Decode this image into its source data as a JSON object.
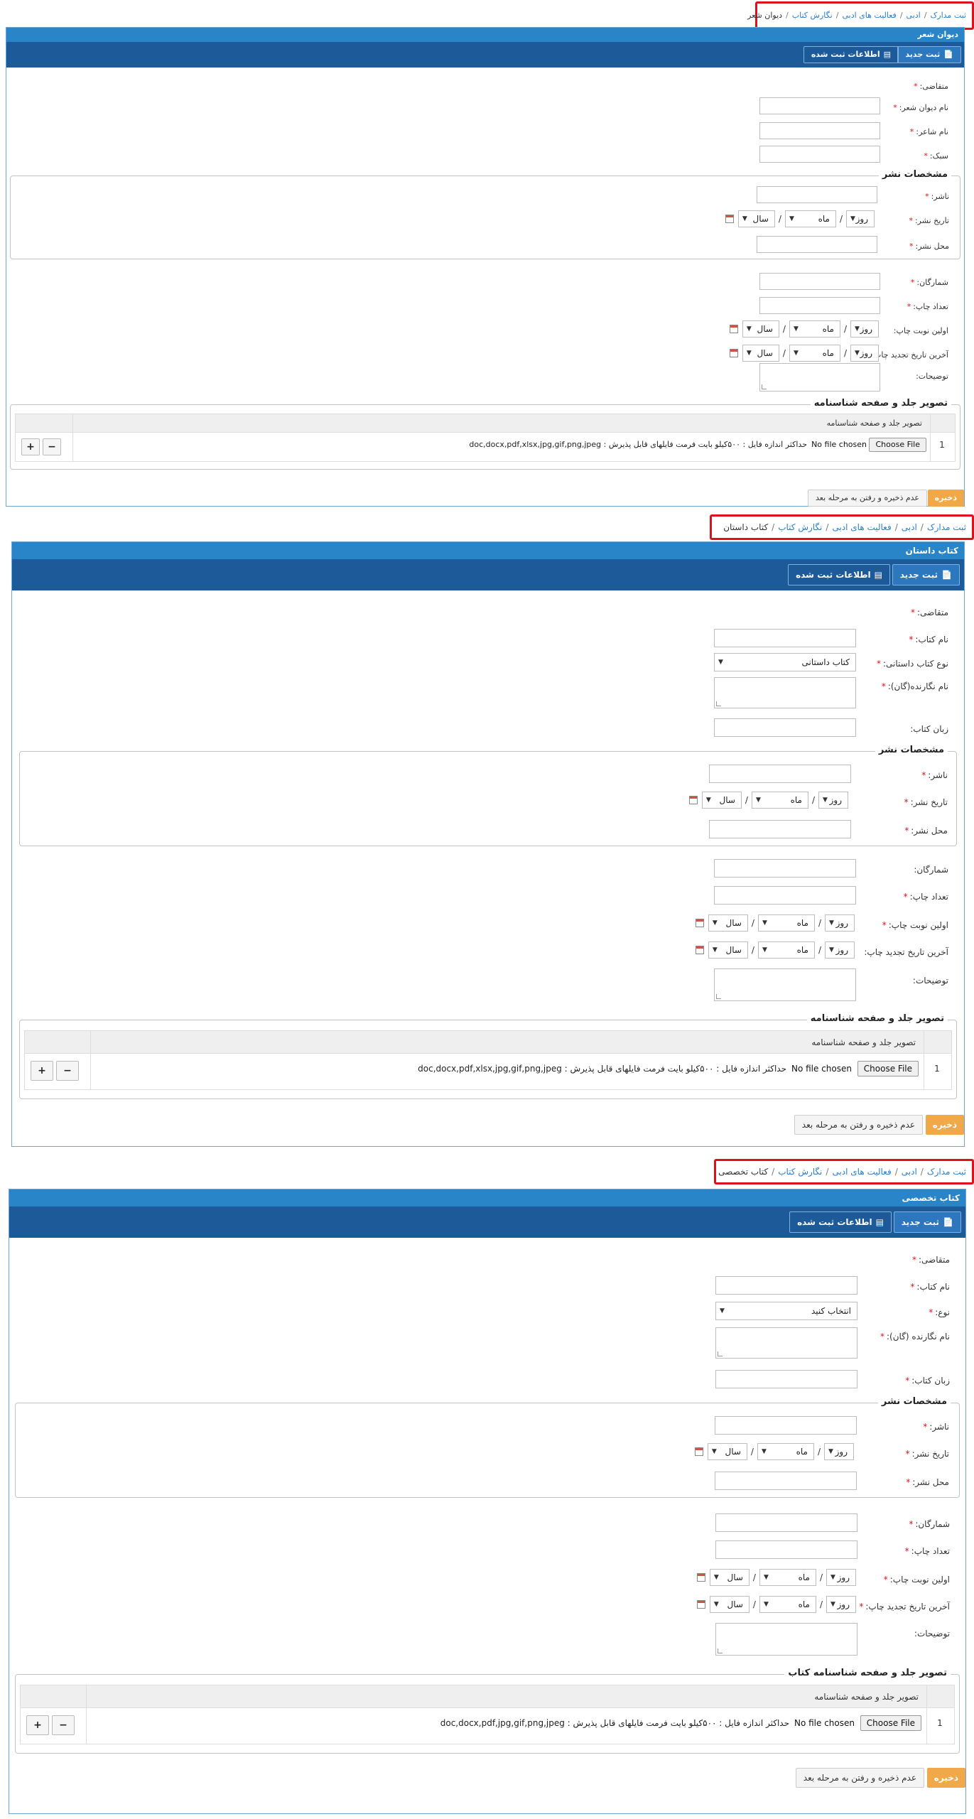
{
  "common": {
    "tab_new": "ثبت جدید",
    "tab_info": "اطلاعات ثبت شده",
    "legend_publish": "مشخصات نشر",
    "th_image": "تصویر جلد و صفحه شناسنامه",
    "choose_file": "Choose File",
    "no_file": "No file chosen",
    "hint": "حداکثر اندازه فایل : ۵۰۰کیلو بایت فرمت فایلهای قابل پذیرش : doc,docx,pdf,xlsx,jpg,gif,png,jpeg",
    "hint_alt": "حداکثر اندازه فایل : ۵۰۰کیلو بایت فرمت فایلهای قابل پذیرش : doc,docx,pdf,jpg,gif,png,jpeg",
    "row_num": "1",
    "plus": "+",
    "minus": "−",
    "save": "ذخیره",
    "skip": "عدم ذخیره و رفتن به مرحله بعد",
    "day": "روز",
    "month": "ماه",
    "year": "سال",
    "slash": "/",
    "star": "*"
  },
  "sections": [
    {
      "breadcrumb": [
        "ثبت مدارک",
        "ادبی",
        "فعالیت های ادبی",
        "نگارش کتاب",
        "دیوان شعر"
      ],
      "panel_title": "دیوان شعر",
      "applicant_label": "متقاضی:",
      "name_label": "نام دیوان شعر:",
      "poet_label": "نام شاعر:",
      "style_label": "سبک:",
      "publisher_label": "ناشر:",
      "pubdate_label": "تاریخ نشر:",
      "pubplace_label": "محل نشر:",
      "circulation_label": "شمارگان:",
      "printcount_label": "تعداد چاپ:",
      "firstprint_label": "اولین نوبت چاپ:",
      "lastreprint_label": "آخرین تاریخ تجدید چاپ:",
      "desc_label": "توضیحات:",
      "legend_image": "تصویر جلد و صفحه شناسنامه"
    },
    {
      "breadcrumb": [
        "ثبت مدارک",
        "ادبی",
        "فعالیت های ادبی",
        "نگارش کتاب",
        "کتاب داستان"
      ],
      "panel_title": "کتاب داستان",
      "applicant_label": "متقاضی:",
      "name_label": "نام کتاب:",
      "type_label": "نوع کتاب داستانی:",
      "type_value": "کتاب داستانی",
      "author_label": "نام نگارنده(گان):",
      "lang_label": "زبان کتاب:",
      "publisher_label": "ناشر:",
      "pubdate_label": "تاریخ نشر:",
      "pubplace_label": "محل نشر:",
      "circulation_label": "شمارگان:",
      "printcount_label": "تعداد چاپ:",
      "firstprint_label": "اولین نوبت چاپ:",
      "lastreprint_label": "آخرین تاریخ تجدید چاپ:",
      "desc_label": "توضیحات:",
      "legend_image": "تصویر جلد و صفحه شناسنامه"
    },
    {
      "breadcrumb": [
        "ثبت مدارک",
        "ادبی",
        "فعالیت های ادبی",
        "نگارش کتاب",
        "کتاب تخصصی"
      ],
      "panel_title": "کتاب تخصصی",
      "applicant_label": "متقاضی:",
      "name_label": "نام کتاب:",
      "type_label": "نوع:",
      "type_value": "انتخاب کنید",
      "author_label": "نام نگارنده (گان):",
      "lang_label": "زبان کتاب:",
      "publisher_label": "ناشر:",
      "pubdate_label": "تاریخ نشر:",
      "pubplace_label": "محل نشر:",
      "circulation_label": "شمارگان:",
      "printcount_label": "تعداد چاپ:",
      "firstprint_label": "اولین نوبت چاپ:",
      "lastreprint_label": "آخرین تاریخ تجدید چاپ:",
      "desc_label": "توضیحات:",
      "legend_image": "تصویر جلد و صفحه شناسنامه کتاب"
    }
  ],
  "colors": {
    "panel_title_bg": "#2a84c8",
    "tab_bar_bg": "#1c5a99",
    "required": "#e0101a",
    "save_button": "#f0a848",
    "highlight_border": "#e0101a",
    "link": "#2a7fc9"
  }
}
